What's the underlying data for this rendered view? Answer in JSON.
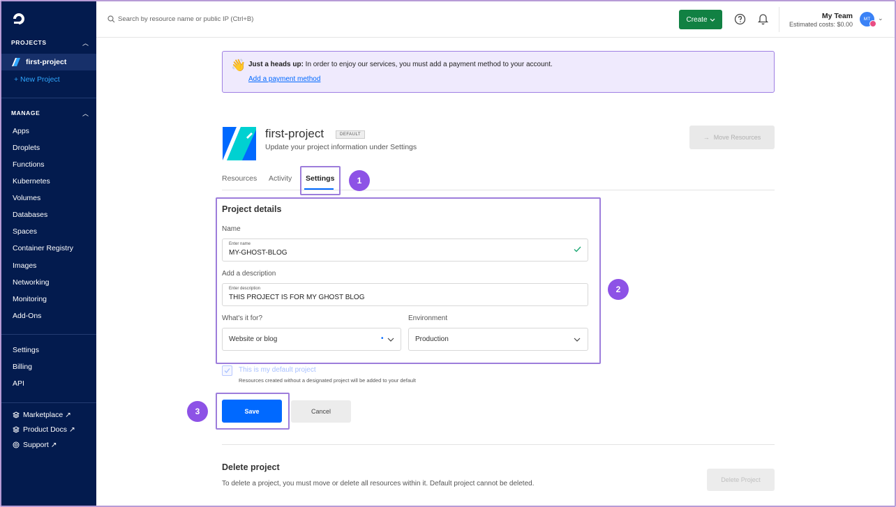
{
  "sidebar": {
    "projects_heading": "PROJECTS",
    "current_project": "first-project",
    "new_project": "+ New Project",
    "manage_heading": "MANAGE",
    "manage_items": [
      "Apps",
      "Droplets",
      "Functions",
      "Kubernetes",
      "Volumes",
      "Databases",
      "Spaces",
      "Container Registry",
      "Images",
      "Networking",
      "Monitoring",
      "Add-Ons"
    ],
    "account_items": [
      "Settings",
      "Billing",
      "API"
    ],
    "external_items": [
      "Marketplace ↗",
      "Product Docs ↗",
      "Support ↗"
    ]
  },
  "topbar": {
    "search_placeholder": "Search by resource name or public IP (Ctrl+B)",
    "create_label": "Create",
    "team_name": "My Team",
    "estimated_costs": "Estimated costs: $0.00",
    "avatar_initials": "MT"
  },
  "banner": {
    "bold": "Just a heads up:",
    "text": " In order to enjoy our services, you must add a payment method to your account.",
    "link": "Add a payment method"
  },
  "project": {
    "title": "first-project",
    "badge": "DEFAULT",
    "subtitle": "Update your project information under Settings",
    "move_resources": "Move Resources"
  },
  "tabs": [
    "Resources",
    "Activity",
    "Settings"
  ],
  "steps": [
    "1",
    "2",
    "3"
  ],
  "form": {
    "section_title": "Project details",
    "name_label": "Name",
    "name_small": "Enter name",
    "name_value": "MY-GHOST-BLOG",
    "desc_label": "Add a description",
    "desc_small": "Enter description",
    "desc_value": "THIS PROJECT IS FOR MY GHOST BLOG",
    "purpose_label": "What's it for?",
    "purpose_value": "Website or blog",
    "env_label": "Environment",
    "env_value": "Production",
    "default_checkbox": "This is my default project",
    "default_help": "Resources created without a designated project will be added to your default",
    "save": "Save",
    "cancel": "Cancel"
  },
  "delete": {
    "title": "Delete project",
    "description": "To delete a project, you must move or delete all resources within it. Default project cannot be deleted.",
    "button": "Delete Project"
  },
  "colors": {
    "sidebar": "#031b4e",
    "accent": "#0069ff",
    "create": "#118143",
    "highlight": "#9d7ddb",
    "step_badge": "#8d52e6"
  }
}
